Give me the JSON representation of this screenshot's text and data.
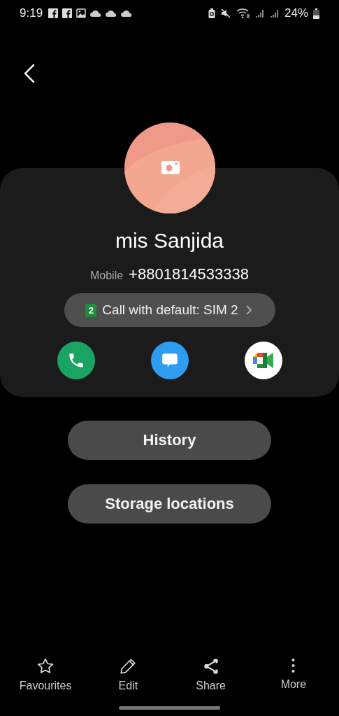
{
  "status_bar": {
    "time": "9:19",
    "battery": "24%"
  },
  "contact": {
    "name": "mis Sanjida",
    "phone_label": "Mobile",
    "phone": "+8801814533338"
  },
  "sim_button": {
    "sim_number": "2",
    "label": "Call with default: SIM 2"
  },
  "actions": [
    {
      "kind": "call"
    },
    {
      "kind": "message"
    },
    {
      "kind": "video"
    }
  ],
  "buttons": [
    "History",
    "Storage locations"
  ],
  "bottom_bar": [
    {
      "kind": "star",
      "label": "Favourites"
    },
    {
      "kind": "edit",
      "label": "Edit"
    },
    {
      "kind": "share",
      "label": "Share"
    },
    {
      "kind": "more",
      "label": "More"
    }
  ]
}
